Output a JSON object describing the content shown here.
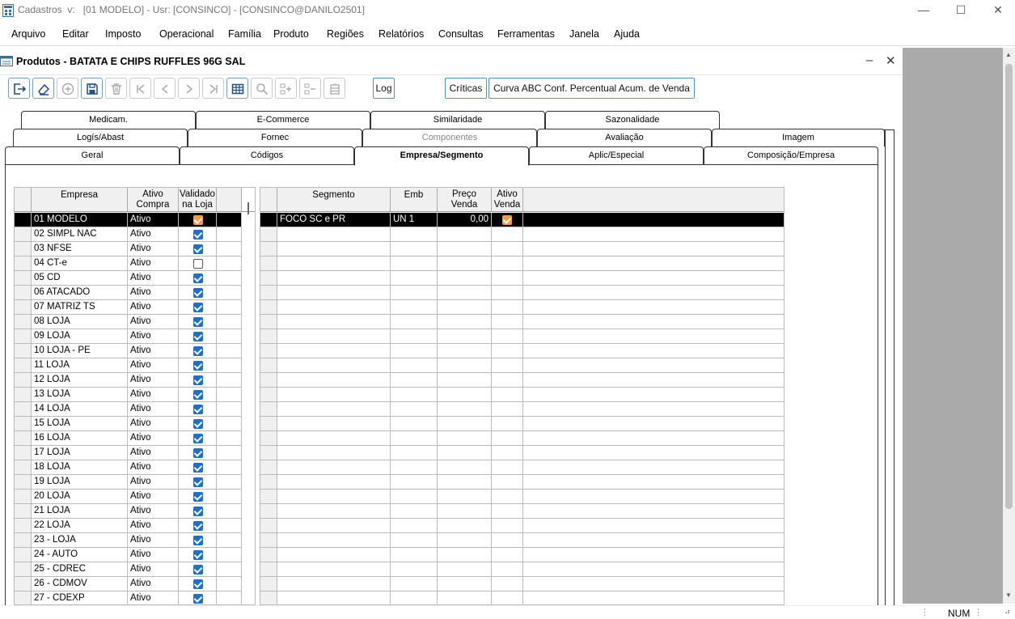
{
  "window": {
    "title": "Cadastros  v:   [01 MODELO] - Usr: [CONSINCO] - [CONSINCO@DANILO2501]",
    "minimize": "—",
    "maximize": "☐",
    "close": "✕"
  },
  "menu": [
    "Arquivo",
    "Editar",
    "Imposto",
    "Operacional",
    "Família",
    "Produto",
    "Regiões",
    "Relatórios",
    "Consultas",
    "Ferramentas",
    "Janela",
    "Ajuda"
  ],
  "child": {
    "title": "Produtos - BATATA E CHIPS RUFFLES 96G SAL",
    "minimize": "–",
    "close": "✕"
  },
  "toolbar": {
    "log": "Log",
    "criticas": "Críticas",
    "curva": "Curva ABC Conf. Percentual Acum. de Venda"
  },
  "tabs": {
    "row1": [
      "Medicam.",
      "E-Commerce",
      "Similaridade",
      "Sazonalidade"
    ],
    "row2": [
      "Logís/Abast",
      "Fornec",
      "Componentes",
      "Avaliação",
      "Imagem"
    ],
    "row3": [
      "Geral",
      "Códigos",
      "Empresa/Segmento",
      "Aplic/Especial",
      "Composição/Empresa"
    ]
  },
  "empresa_grid": {
    "headers": [
      "Empresa",
      "Ativo\nCompra",
      "Validado\nna Loja"
    ],
    "rows": [
      {
        "empresa": "01 MODELO",
        "ativo": "Ativo",
        "validado": true
      },
      {
        "empresa": "02 SIMPL NAC",
        "ativo": "Ativo",
        "validado": true
      },
      {
        "empresa": "03 NFSE",
        "ativo": "Ativo",
        "validado": true
      },
      {
        "empresa": "04 CT-e",
        "ativo": "Ativo",
        "validado": false
      },
      {
        "empresa": "05 CD",
        "ativo": "Ativo",
        "validado": true
      },
      {
        "empresa": "06 ATACADO",
        "ativo": "Ativo",
        "validado": true
      },
      {
        "empresa": "07 MATRIZ TS",
        "ativo": "Ativo",
        "validado": true
      },
      {
        "empresa": "08 LOJA",
        "ativo": "Ativo",
        "validado": true
      },
      {
        "empresa": "09 LOJA",
        "ativo": "Ativo",
        "validado": true
      },
      {
        "empresa": "10 LOJA - PE",
        "ativo": "Ativo",
        "validado": true
      },
      {
        "empresa": "11 LOJA",
        "ativo": "Ativo",
        "validado": true
      },
      {
        "empresa": "12 LOJA",
        "ativo": "Ativo",
        "validado": true
      },
      {
        "empresa": "13 LOJA",
        "ativo": "Ativo",
        "validado": true
      },
      {
        "empresa": "14 LOJA",
        "ativo": "Ativo",
        "validado": true
      },
      {
        "empresa": "15 LOJA",
        "ativo": "Ativo",
        "validado": true
      },
      {
        "empresa": "16 LOJA",
        "ativo": "Ativo",
        "validado": true
      },
      {
        "empresa": "17 LOJA",
        "ativo": "Ativo",
        "validado": true
      },
      {
        "empresa": "18 LOJA",
        "ativo": "Ativo",
        "validado": true
      },
      {
        "empresa": "19 LOJA",
        "ativo": "Ativo",
        "validado": true
      },
      {
        "empresa": "20 LOJA",
        "ativo": "Ativo",
        "validado": true
      },
      {
        "empresa": "21 LOJA",
        "ativo": "Ativo",
        "validado": true
      },
      {
        "empresa": "22 LOJA",
        "ativo": "Ativo",
        "validado": true
      },
      {
        "empresa": "23 - LOJA",
        "ativo": "Ativo",
        "validado": true
      },
      {
        "empresa": "24 - AUTO",
        "ativo": "Ativo",
        "validado": true
      },
      {
        "empresa": "25 - CDREC",
        "ativo": "Ativo",
        "validado": true
      },
      {
        "empresa": "26 - CDMOV",
        "ativo": "Ativo",
        "validado": true
      },
      {
        "empresa": "27 - CDEXP",
        "ativo": "Ativo",
        "validado": true
      }
    ]
  },
  "segmento_grid": {
    "headers": [
      "Segmento",
      "Emb",
      "Preço\nVenda",
      "Ativo\nVenda"
    ],
    "rows": [
      {
        "segmento": "FOCO SC e PR",
        "emb": "UN  1",
        "preco": "0,00",
        "ativo": true
      }
    ]
  },
  "status": {
    "num": "NUM"
  },
  "colors": {
    "accent": "#1f6fc7",
    "selected_checkbox": "#f59a3e",
    "mdi_background": "#aaaaaa"
  }
}
